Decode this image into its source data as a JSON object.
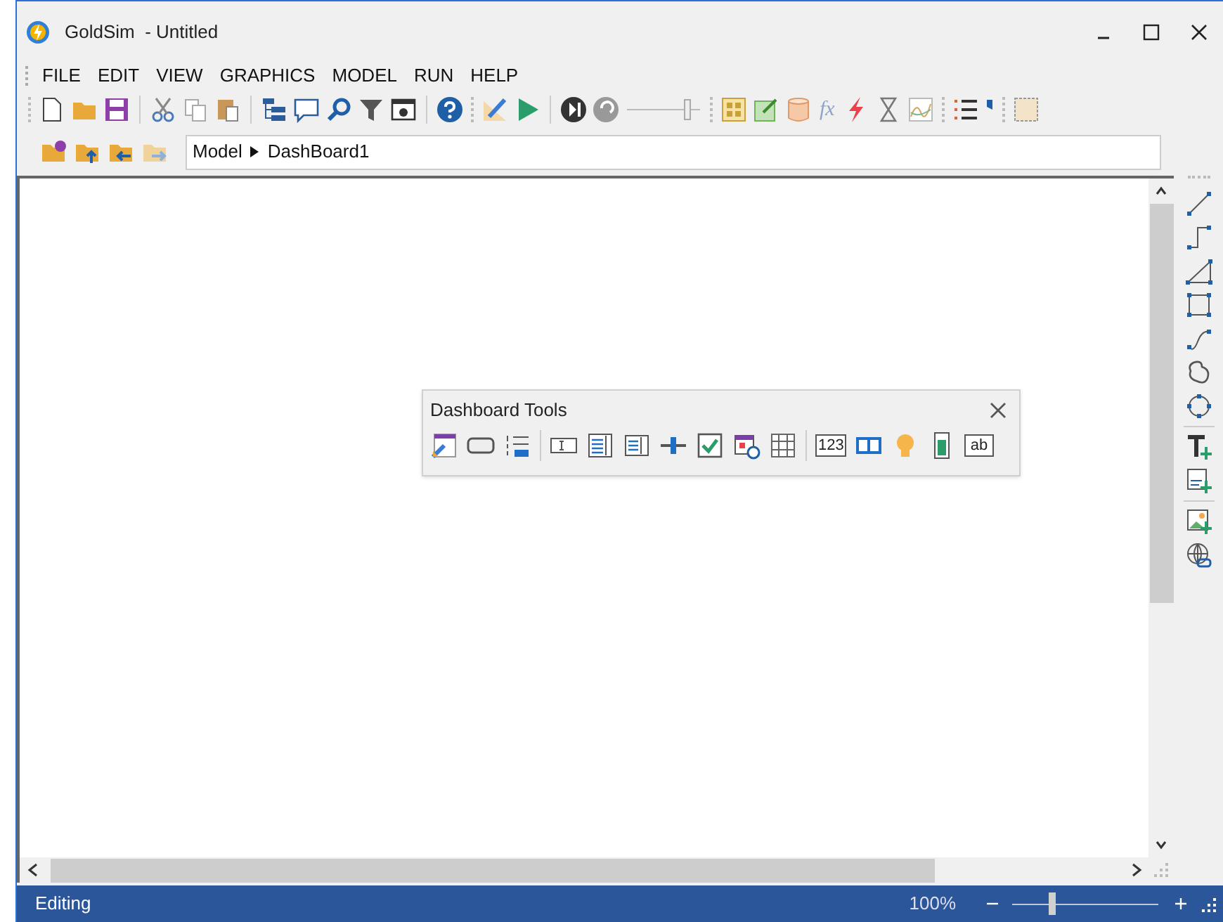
{
  "window": {
    "title": "GoldSim  - Untitled"
  },
  "menu": [
    "FILE",
    "EDIT",
    "VIEW",
    "GRAPHICS",
    "MODEL",
    "RUN",
    "HELP"
  ],
  "toolbar": {
    "function_glyph": "fx"
  },
  "breadcrumb": [
    "Model",
    "DashBoard1"
  ],
  "palette": {
    "title": "Dashboard Tools",
    "glyphs": [
      "123",
      "ab"
    ]
  },
  "status_bar": {
    "text": "Editing",
    "zoom": "100%",
    "zoom_slider": {
      "level": 0.26
    }
  }
}
